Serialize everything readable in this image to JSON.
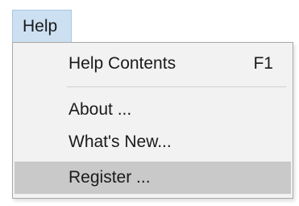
{
  "menubar": {
    "help_label": "Help"
  },
  "help_menu": {
    "items": [
      {
        "label": "Help Contents",
        "shortcut": "F1"
      },
      {
        "label": "About ..."
      },
      {
        "label": "What's New..."
      },
      {
        "label": "Register ..."
      }
    ],
    "highlighted_item": "Register ..."
  }
}
